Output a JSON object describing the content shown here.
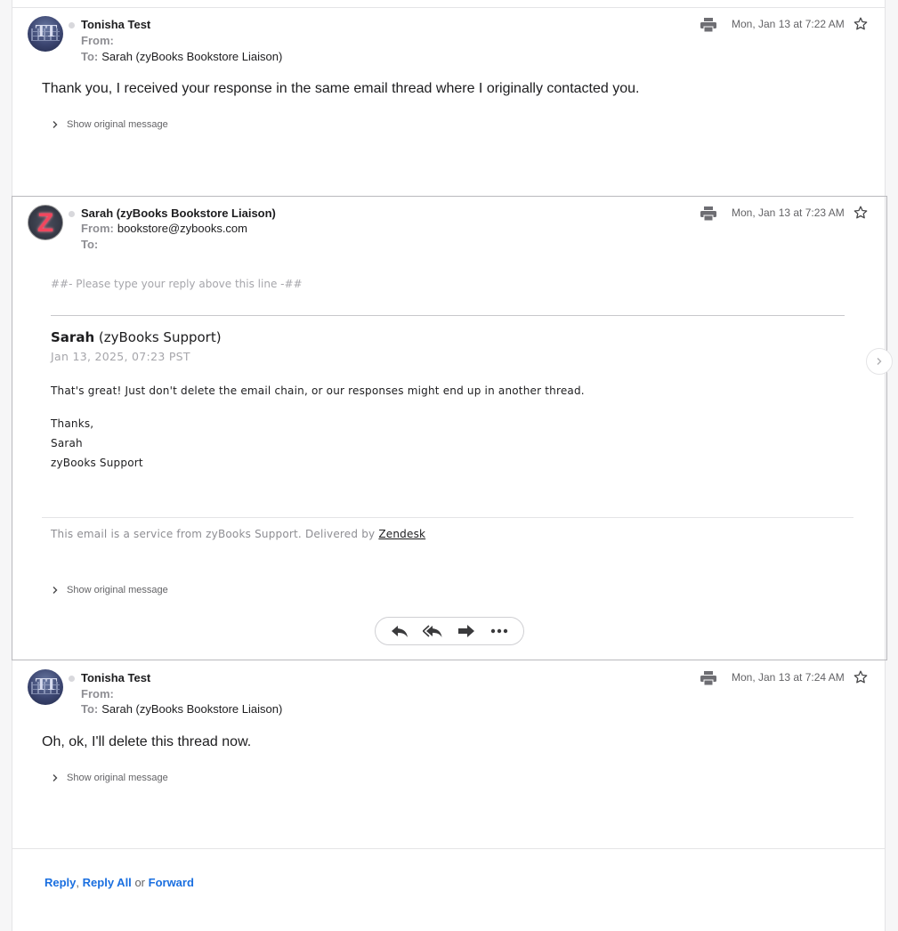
{
  "messages": [
    {
      "avatar_initials": "TT",
      "sender": "Tonisha Test",
      "from_label": "From:",
      "from_value": "",
      "to_label": "To:",
      "to_value": "Sarah (zyBooks Bookstore Liaison)",
      "date": "Mon, Jan 13 at 7:22 AM",
      "body": "Thank you, I received your response in the same email thread where I originally contacted you.",
      "show_original": "Show original message"
    },
    {
      "avatar_initials": "Z",
      "sender": "Sarah (zyBooks Bookstore Liaison)",
      "from_label": "From:",
      "from_value": "bookstore@zybooks.com",
      "to_label": "To:",
      "to_value": "",
      "date": "Mon, Jan 13 at 7:23 AM",
      "reply_hint": "##- Please type your reply above this line -##",
      "author_name": "Sarah",
      "author_org": "(zyBooks Support)",
      "author_date": "Jan 13, 2025, 07:23 PST",
      "paragraph_1": "That's great! Just don't delete the email chain, or our responses might end up in another thread.",
      "sign_1": "Thanks,",
      "sign_2": "Sarah",
      "sign_3": "zyBooks Support",
      "footer_text": "This email is a service from zyBooks Support. Delivered by",
      "footer_link": "Zendesk",
      "show_original": "Show original message"
    },
    {
      "avatar_initials": "TT",
      "sender": "Tonisha Test",
      "from_label": "From:",
      "from_value": "",
      "to_label": "To:",
      "to_value": "Sarah (zyBooks Bookstore Liaison)",
      "date": "Mon, Jan 13 at 7:24 AM",
      "body": "Oh, ok, I'll delete this thread now.",
      "show_original": "Show original message"
    }
  ],
  "actions": [
    "reply-icon",
    "reply-all-icon",
    "forward-icon",
    "more-icon"
  ],
  "reply_bar": {
    "reply": "Reply",
    "comma": ",",
    "reply_all": "Reply All",
    "or": "or",
    "forward": "Forward"
  },
  "colors": {
    "link": "#1a6fe0",
    "zy_red": "#f2465e"
  }
}
